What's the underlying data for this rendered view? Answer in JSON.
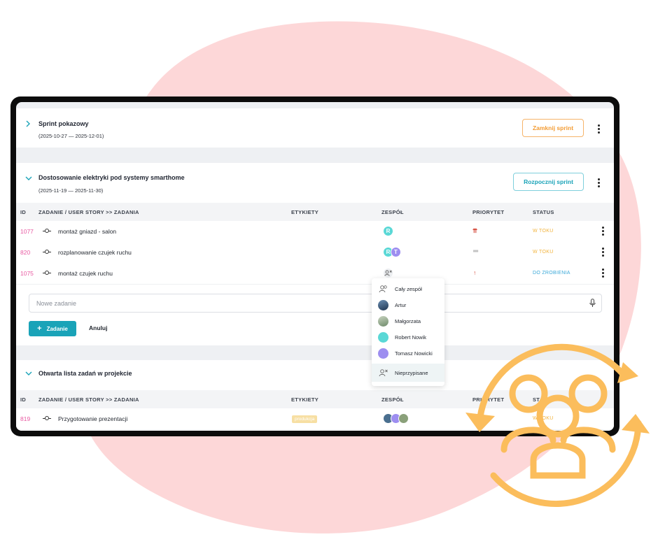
{
  "colors": {
    "accent": "#1aa3b8",
    "orange": "#f39c34",
    "blob": "#fdd7d8",
    "icon": "#fbbd5c",
    "status_in_progress": "#f2b33d",
    "status_todo": "#3aa8d8",
    "id_color": "#e85aa2"
  },
  "sprints": [
    {
      "title": "Sprint pokazowy",
      "dates": "(2025-10-27 — 2025-12-01)",
      "action_label": "Zamknij sprint",
      "expanded": false
    },
    {
      "title": "Dostosowanie elektryki pod systemy smarthome",
      "dates": "(2025-11-19 — 2025-11-30)",
      "action_label": "Rozpocznij sprint",
      "expanded": true
    }
  ],
  "table_headers": {
    "id": "ID",
    "task": "ZADANIE / USER STORY >> ZADANIA",
    "labels": "ETYKIETY",
    "team": "ZESPÓŁ",
    "priority": "PRIORYTET",
    "status": "STATUS"
  },
  "tasks": [
    {
      "id": "1077",
      "name": "montaż gniazd - salon",
      "priority": "highest",
      "priority_icon": "⇈",
      "status": "W TOKU",
      "team": [
        "R"
      ]
    },
    {
      "id": "820",
      "name": "rozplanowanie czujek ruchu",
      "priority": "medium",
      "priority_icon": "═",
      "status": "W TOKU",
      "team": [
        "R",
        "T"
      ]
    },
    {
      "id": "1075",
      "name": "montaż czujek ruchu",
      "priority": "high",
      "priority_icon": "↑",
      "status": "DO ZROBIENIA",
      "team": []
    }
  ],
  "new_task": {
    "placeholder": "Nowe zadanie",
    "add_label": "Zadanie",
    "add_prefix": "+",
    "cancel_label": "Anuluj"
  },
  "assignee_dropdown": {
    "items": [
      "Cały zespół",
      "Artur",
      "Małgorzata",
      "Robert Nowik",
      "Tomasz Nowicki",
      "Nieprzypisane"
    ]
  },
  "backlog": {
    "title": "Otwarta lista zadań w projekcie",
    "headers": {
      "id": "ID",
      "task": "ZADANIE / USER STORY >> ZADANIA",
      "labels": "ETYKIETY",
      "team": "ZESPÓŁ",
      "priority": "PRIORYTET",
      "status": "STATUS"
    },
    "rows": [
      {
        "id": "819",
        "name": "Przygotowanie prezentacji",
        "tag": "produkcja",
        "status": "W TOKU"
      }
    ]
  }
}
